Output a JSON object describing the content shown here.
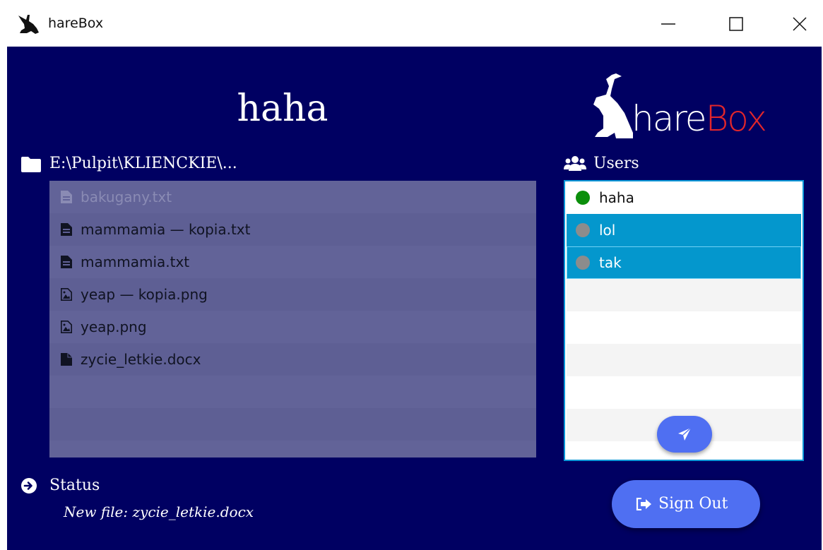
{
  "window": {
    "title": "hareBox",
    "logged_user": "haha",
    "logo_part1": "hare",
    "logo_part2": "Box"
  },
  "files": {
    "path": "E:\\Pulpit\\KLIENCKIE\\...",
    "items": [
      {
        "name": "bakugany.txt",
        "icon": "text-file-icon",
        "disabled": true
      },
      {
        "name": "mammamia — kopia.txt",
        "icon": "text-file-icon",
        "disabled": false
      },
      {
        "name": "mammamia.txt",
        "icon": "text-file-icon",
        "disabled": false
      },
      {
        "name": "yeap — kopia.png",
        "icon": "image-file-icon",
        "disabled": false
      },
      {
        "name": "yeap.png",
        "icon": "image-file-icon",
        "disabled": false
      },
      {
        "name": "zycie_letkie.docx",
        "icon": "file-icon",
        "disabled": false
      }
    ]
  },
  "users": {
    "label": "Users",
    "items": [
      {
        "name": "haha",
        "online": true,
        "selected": false
      },
      {
        "name": "lol",
        "online": false,
        "selected": true
      },
      {
        "name": "tak",
        "online": false,
        "selected": true
      }
    ]
  },
  "status": {
    "label": "Status",
    "message": "New file: zycie_letkie.docx"
  },
  "actions": {
    "sign_out": "Sign Out"
  },
  "colors": {
    "background": "#000062",
    "file_panel": "#626398",
    "selection": "#0497cd",
    "accent_button": "#4f6ff2",
    "online_dot": "#0b8f0b",
    "offline_dot": "#8c8c8c",
    "logo_box": "#e3262b"
  }
}
